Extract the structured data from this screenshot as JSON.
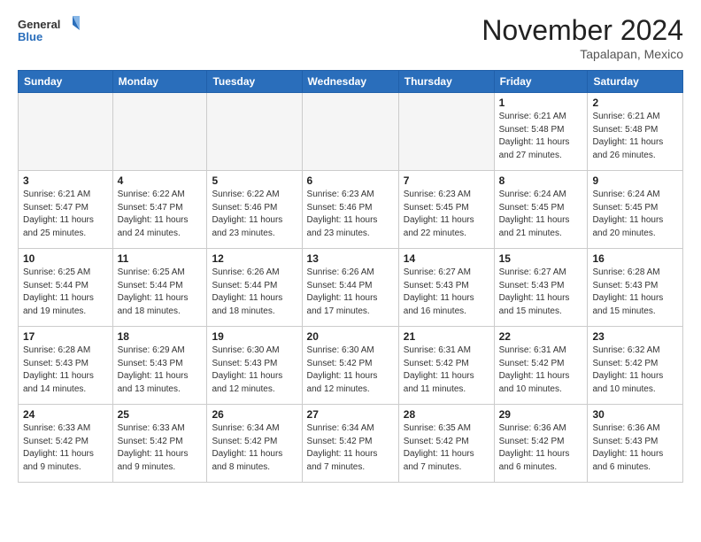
{
  "header": {
    "logo_line1": "General",
    "logo_line2": "Blue",
    "month": "November 2024",
    "location": "Tapalapan, Mexico"
  },
  "weekdays": [
    "Sunday",
    "Monday",
    "Tuesday",
    "Wednesday",
    "Thursday",
    "Friday",
    "Saturday"
  ],
  "weeks": [
    [
      {
        "day": "",
        "info": ""
      },
      {
        "day": "",
        "info": ""
      },
      {
        "day": "",
        "info": ""
      },
      {
        "day": "",
        "info": ""
      },
      {
        "day": "",
        "info": ""
      },
      {
        "day": "1",
        "info": "Sunrise: 6:21 AM\nSunset: 5:48 PM\nDaylight: 11 hours\nand 27 minutes."
      },
      {
        "day": "2",
        "info": "Sunrise: 6:21 AM\nSunset: 5:48 PM\nDaylight: 11 hours\nand 26 minutes."
      }
    ],
    [
      {
        "day": "3",
        "info": "Sunrise: 6:21 AM\nSunset: 5:47 PM\nDaylight: 11 hours\nand 25 minutes."
      },
      {
        "day": "4",
        "info": "Sunrise: 6:22 AM\nSunset: 5:47 PM\nDaylight: 11 hours\nand 24 minutes."
      },
      {
        "day": "5",
        "info": "Sunrise: 6:22 AM\nSunset: 5:46 PM\nDaylight: 11 hours\nand 23 minutes."
      },
      {
        "day": "6",
        "info": "Sunrise: 6:23 AM\nSunset: 5:46 PM\nDaylight: 11 hours\nand 23 minutes."
      },
      {
        "day": "7",
        "info": "Sunrise: 6:23 AM\nSunset: 5:45 PM\nDaylight: 11 hours\nand 22 minutes."
      },
      {
        "day": "8",
        "info": "Sunrise: 6:24 AM\nSunset: 5:45 PM\nDaylight: 11 hours\nand 21 minutes."
      },
      {
        "day": "9",
        "info": "Sunrise: 6:24 AM\nSunset: 5:45 PM\nDaylight: 11 hours\nand 20 minutes."
      }
    ],
    [
      {
        "day": "10",
        "info": "Sunrise: 6:25 AM\nSunset: 5:44 PM\nDaylight: 11 hours\nand 19 minutes."
      },
      {
        "day": "11",
        "info": "Sunrise: 6:25 AM\nSunset: 5:44 PM\nDaylight: 11 hours\nand 18 minutes."
      },
      {
        "day": "12",
        "info": "Sunrise: 6:26 AM\nSunset: 5:44 PM\nDaylight: 11 hours\nand 18 minutes."
      },
      {
        "day": "13",
        "info": "Sunrise: 6:26 AM\nSunset: 5:44 PM\nDaylight: 11 hours\nand 17 minutes."
      },
      {
        "day": "14",
        "info": "Sunrise: 6:27 AM\nSunset: 5:43 PM\nDaylight: 11 hours\nand 16 minutes."
      },
      {
        "day": "15",
        "info": "Sunrise: 6:27 AM\nSunset: 5:43 PM\nDaylight: 11 hours\nand 15 minutes."
      },
      {
        "day": "16",
        "info": "Sunrise: 6:28 AM\nSunset: 5:43 PM\nDaylight: 11 hours\nand 15 minutes."
      }
    ],
    [
      {
        "day": "17",
        "info": "Sunrise: 6:28 AM\nSunset: 5:43 PM\nDaylight: 11 hours\nand 14 minutes."
      },
      {
        "day": "18",
        "info": "Sunrise: 6:29 AM\nSunset: 5:43 PM\nDaylight: 11 hours\nand 13 minutes."
      },
      {
        "day": "19",
        "info": "Sunrise: 6:30 AM\nSunset: 5:43 PM\nDaylight: 11 hours\nand 12 minutes."
      },
      {
        "day": "20",
        "info": "Sunrise: 6:30 AM\nSunset: 5:42 PM\nDaylight: 11 hours\nand 12 minutes."
      },
      {
        "day": "21",
        "info": "Sunrise: 6:31 AM\nSunset: 5:42 PM\nDaylight: 11 hours\nand 11 minutes."
      },
      {
        "day": "22",
        "info": "Sunrise: 6:31 AM\nSunset: 5:42 PM\nDaylight: 11 hours\nand 10 minutes."
      },
      {
        "day": "23",
        "info": "Sunrise: 6:32 AM\nSunset: 5:42 PM\nDaylight: 11 hours\nand 10 minutes."
      }
    ],
    [
      {
        "day": "24",
        "info": "Sunrise: 6:33 AM\nSunset: 5:42 PM\nDaylight: 11 hours\nand 9 minutes."
      },
      {
        "day": "25",
        "info": "Sunrise: 6:33 AM\nSunset: 5:42 PM\nDaylight: 11 hours\nand 9 minutes."
      },
      {
        "day": "26",
        "info": "Sunrise: 6:34 AM\nSunset: 5:42 PM\nDaylight: 11 hours\nand 8 minutes."
      },
      {
        "day": "27",
        "info": "Sunrise: 6:34 AM\nSunset: 5:42 PM\nDaylight: 11 hours\nand 7 minutes."
      },
      {
        "day": "28",
        "info": "Sunrise: 6:35 AM\nSunset: 5:42 PM\nDaylight: 11 hours\nand 7 minutes."
      },
      {
        "day": "29",
        "info": "Sunrise: 6:36 AM\nSunset: 5:42 PM\nDaylight: 11 hours\nand 6 minutes."
      },
      {
        "day": "30",
        "info": "Sunrise: 6:36 AM\nSunset: 5:43 PM\nDaylight: 11 hours\nand 6 minutes."
      }
    ]
  ]
}
